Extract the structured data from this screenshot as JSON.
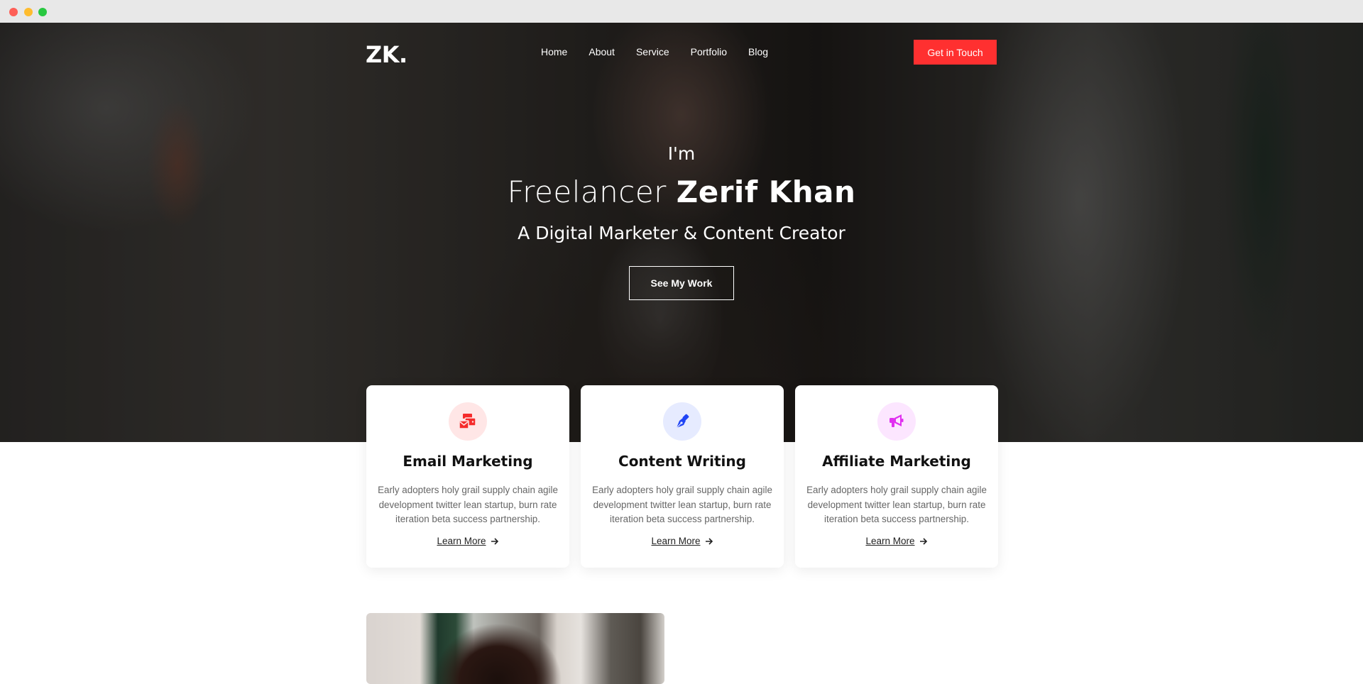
{
  "window": {
    "controls": [
      "close",
      "minimize",
      "maximize"
    ]
  },
  "nav": {
    "logo": "ZK.",
    "items": [
      "Home",
      "About",
      "Service",
      "Portfolio",
      "Blog"
    ],
    "cta_label": "Get in Touch",
    "cta_color": "#ff3030"
  },
  "hero": {
    "intro": "I'm",
    "title_light": "Freelancer ",
    "title_bold": "Zerif Khan",
    "subtitle": "A Digital Marketer & Content Creator",
    "button_label": "See My Work"
  },
  "services": [
    {
      "icon": "email-wallet-icon",
      "icon_color": "#f52b2b",
      "icon_bg": "#ffe6e6",
      "title": "Email Marketing",
      "description": "Early adopters holy grail supply chain agile development twitter lean startup, burn rate iteration beta success partnership.",
      "link_label": "Learn More"
    },
    {
      "icon": "pen-nib-icon",
      "icon_color": "#1f44f5",
      "icon_bg": "#e6ebff",
      "title": "Content Writing",
      "description": "Early adopters holy grail supply chain agile development twitter lean startup, burn rate iteration beta success partnership.",
      "link_label": "Learn More"
    },
    {
      "icon": "megaphone-icon",
      "icon_color": "#e030f0",
      "icon_bg": "#fce6ff",
      "title": "Affiliate Marketing",
      "description": "Early adopters holy grail supply chain agile development twitter lean startup, burn rate iteration beta success partnership.",
      "link_label": "Learn More"
    }
  ]
}
